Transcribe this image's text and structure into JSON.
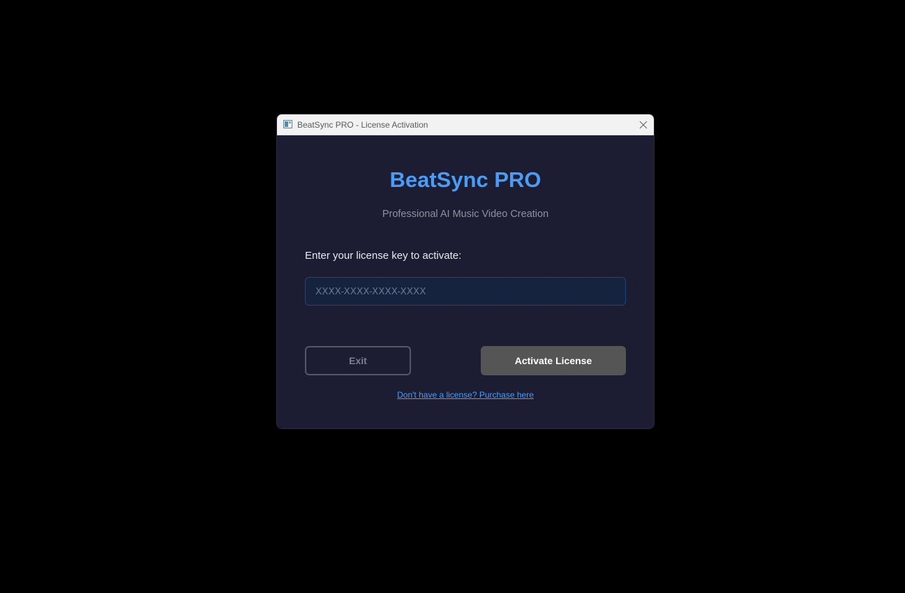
{
  "window": {
    "title": "BeatSync PRO - License Activation",
    "icon": "app-window-icon",
    "close_icon": "close-icon"
  },
  "main": {
    "title": "BeatSync PRO",
    "subtitle": "Professional AI Music Video Creation",
    "prompt_label": "Enter your license key to activate:",
    "license_input": {
      "value": "",
      "placeholder": "XXXX-XXXX-XXXX-XXXX"
    },
    "exit_label": "Exit",
    "activate_label": "Activate License",
    "purchase_link_text": "Don't have a license? Purchase here"
  },
  "colors": {
    "desktop_background": "#000000",
    "window_background": "#1c1d33",
    "titlebar_background": "#f2f2f2",
    "accent": "#4a9cf5",
    "activate_button": "#555555",
    "input_background": "#16233f",
    "input_border": "#1e4577"
  }
}
